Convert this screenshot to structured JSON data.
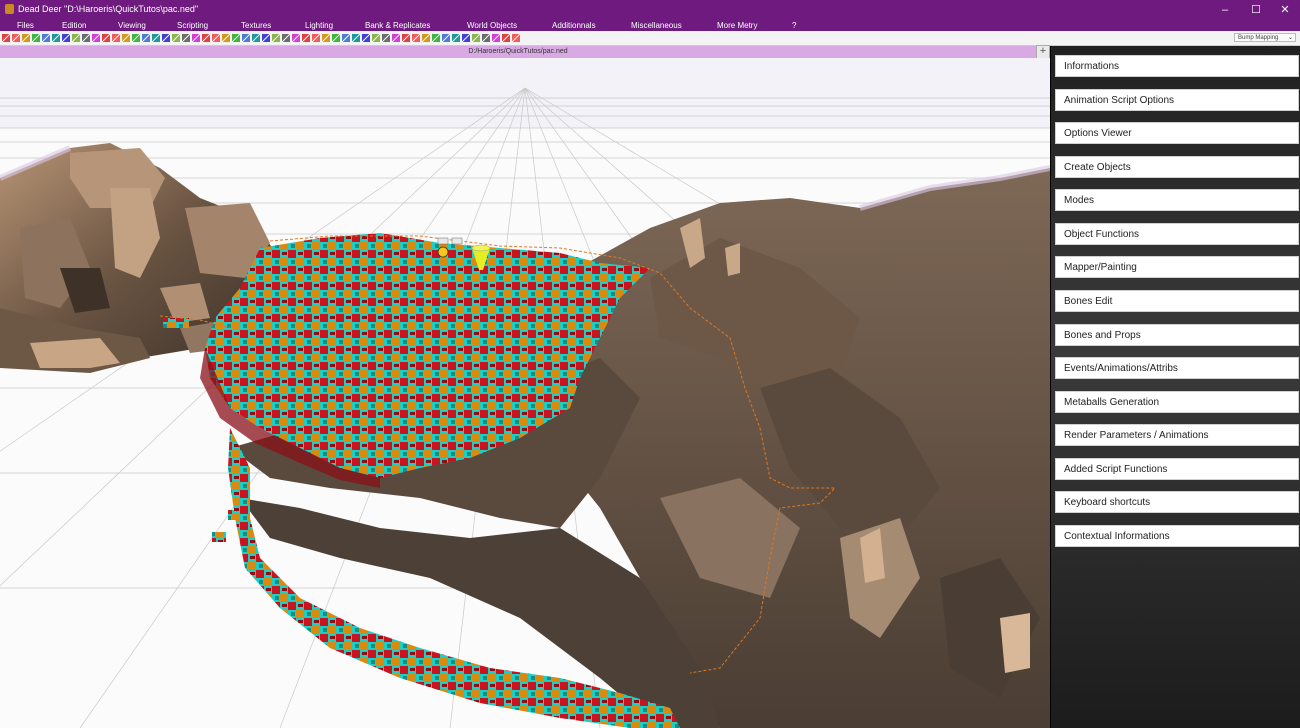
{
  "window": {
    "title": "Dead Deer \"D:\\Haroeris\\QuickTutos\\pac.ned\"",
    "controls": [
      "–",
      "☐",
      "✕"
    ]
  },
  "menu": [
    "Files",
    "Edition",
    "Viewing",
    "Scripting",
    "Textures",
    "Lighting",
    "Bank & Replicates",
    "World Objects",
    "Additionnals",
    "Miscellaneous",
    "More Metry",
    "?"
  ],
  "toolbar": {
    "render_mode": "Bump Mapping"
  },
  "viewport": {
    "file_path": "D:/Haroeris/QuickTutos/pac.ned"
  },
  "panel": {
    "add_button": "+",
    "items": [
      "Informations",
      "Animation Script Options",
      "Options Viewer",
      "Create Objects",
      "Modes",
      "Object Functions",
      "Mapper/Painting",
      "Bones Edit",
      "Bones and Props",
      "Events/Animations/Attribs",
      "Metaballs Generation",
      "Render Parameters / Animations",
      "Added Script Functions",
      "Keyboard shortcuts",
      "Contextual Informations"
    ]
  },
  "colors": {
    "title_bar": "#6e1a7e",
    "path_bar": "#d9a9e4",
    "voxel_red": "#c8141e",
    "voxel_cyan": "#1ccfc4",
    "voxel_orange": "#d98a10",
    "rock": "#7a6250"
  }
}
